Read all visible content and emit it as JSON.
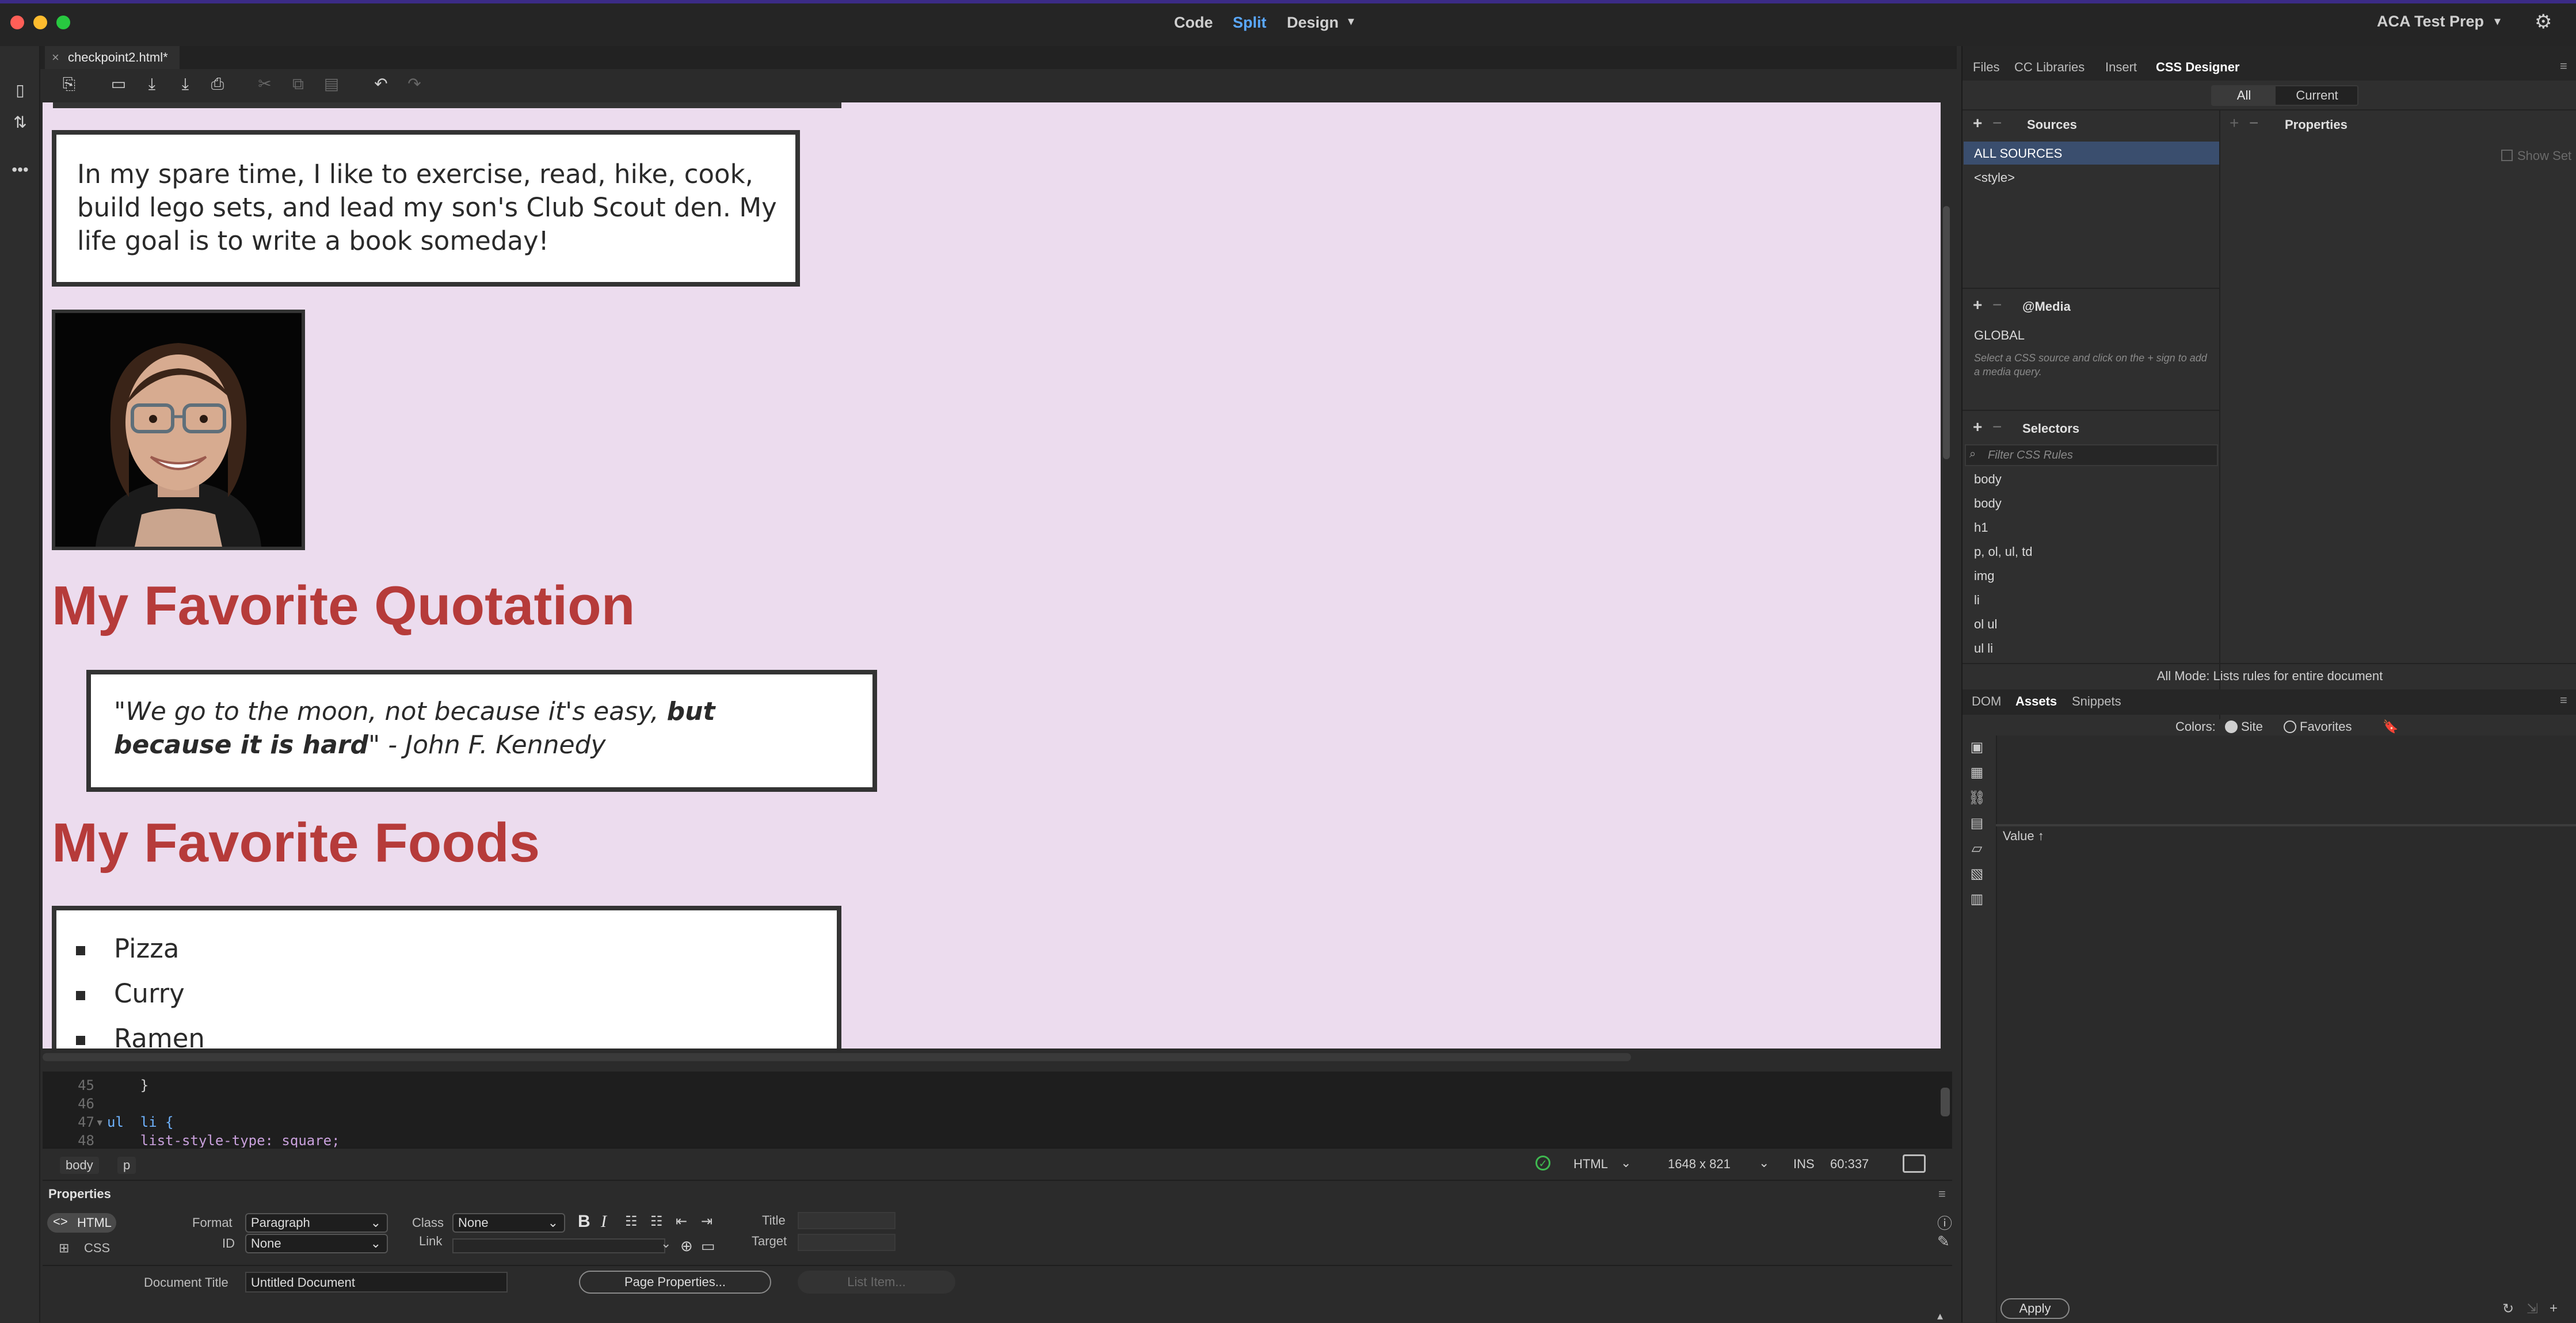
{
  "window": {
    "modes": [
      "Code",
      "Split",
      "Design"
    ],
    "active_mode": "Split",
    "workspace": "ACA Test Prep"
  },
  "document": {
    "tab_name": "checkpoint2.html*"
  },
  "design": {
    "paragraph": "In my spare time, I like to exercise, read, hike, cook, build lego sets, and lead my son's Club Scout den. My life goal is to write a book someday!",
    "heading_quote": "My Favorite Quotation",
    "quote": {
      "normal": "\"We go to the moon, not because it's easy, ",
      "bold": "but because it is hard",
      "tail": "\" - John F. Kennedy"
    },
    "heading_foods": "My Favorite Foods",
    "foods": [
      "Pizza",
      "Curry",
      "Ramen"
    ]
  },
  "code": {
    "lines": [
      {
        "num": "45",
        "text": "    }"
      },
      {
        "num": "46",
        "text": ""
      },
      {
        "num": "47",
        "text": "ul  li {"
      },
      {
        "num": "48",
        "text": "    list-style-type: square;"
      }
    ]
  },
  "tagbar": {
    "tags": [
      "body",
      "p"
    ],
    "doc_type": "HTML",
    "size": "1648 x 821",
    "ins": "INS",
    "position": "60:337"
  },
  "properties": {
    "title": "Properties",
    "html_label": "HTML",
    "css_label": "CSS",
    "format_label": "Format",
    "format_value": "Paragraph",
    "id_label": "ID",
    "id_value": "None",
    "class_label": "Class",
    "class_value": "None",
    "link_label": "Link",
    "title_label": "Title",
    "target_label": "Target",
    "doc_title_label": "Document Title",
    "doc_title_value": "Untitled Document",
    "page_props_btn": "Page Properties...",
    "list_item_btn": "List Item..."
  },
  "right_panel": {
    "tabs": [
      "Files",
      "CC Libraries",
      "Insert",
      "CSS Designer"
    ],
    "active_tab": "CSS Designer",
    "all_btn": "All",
    "current_btn": "Current",
    "sources_title": "Sources",
    "sources": [
      "ALL SOURCES",
      "<style>"
    ],
    "properties_title": "Properties",
    "show_set": "Show Set",
    "media_title": "@Media",
    "media_global": "GLOBAL",
    "media_hint": "Select a CSS source and click on the + sign to add a media query.",
    "selectors_title": "Selectors",
    "filter_placeholder": "Filter CSS Rules",
    "selectors": [
      "body",
      "body",
      "h1",
      "p, ol, ul, td",
      "img",
      "li",
      "ol ul",
      "ul li"
    ],
    "mode_status": "All Mode: Lists rules for entire document",
    "lower_tabs": [
      "DOM",
      "Assets",
      "Snippets"
    ],
    "lower_active": "Assets",
    "colors_label": "Colors:",
    "site_label": "Site",
    "favorites_label": "Favorites",
    "value_header": "Value ↑",
    "apply_btn": "Apply"
  }
}
